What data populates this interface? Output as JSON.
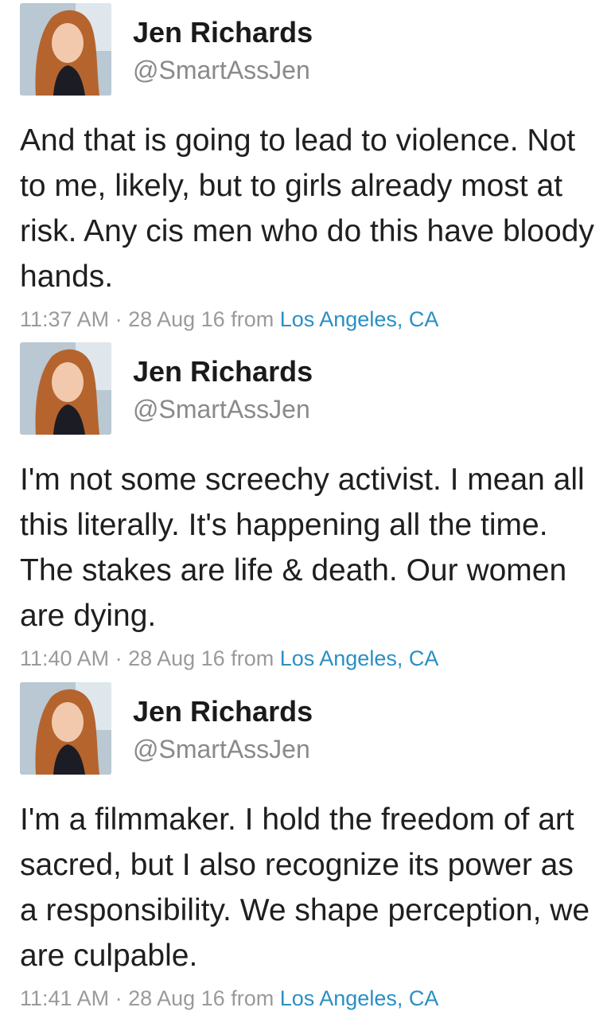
{
  "tweets": [
    {
      "name": "Jen Richards",
      "handle": "@SmartAssJen",
      "text": "And that is going to lead to violence. Not to me, likely, but to girls already most at risk. Any cis men who do this have bloody hands.",
      "time": "11:37 AM · 28 Aug 16",
      "from": "from",
      "location": "Los Angeles, CA"
    },
    {
      "name": "Jen Richards",
      "handle": "@SmartAssJen",
      "text": "I'm not some screechy activist. I mean all this literally. It's happening all the time. The stakes are life & death. Our women are dying.",
      "time": "11:40 AM · 28 Aug 16",
      "from": "from",
      "location": "Los Angeles, CA"
    },
    {
      "name": "Jen Richards",
      "handle": "@SmartAssJen",
      "text": "I'm a filmmaker. I hold the freedom of art sacred, but I also recognize its power as a responsibility. We shape perception, we are culpable.",
      "time": "11:41 AM · 28 Aug 16",
      "from": "from",
      "location": "Los Angeles, CA"
    }
  ],
  "colors": {
    "name": "#1a1a1a",
    "handle": "#8a8a8a",
    "body": "#1f1f1f",
    "meta": "#9a9a9a",
    "location": "#2a8fc4"
  }
}
